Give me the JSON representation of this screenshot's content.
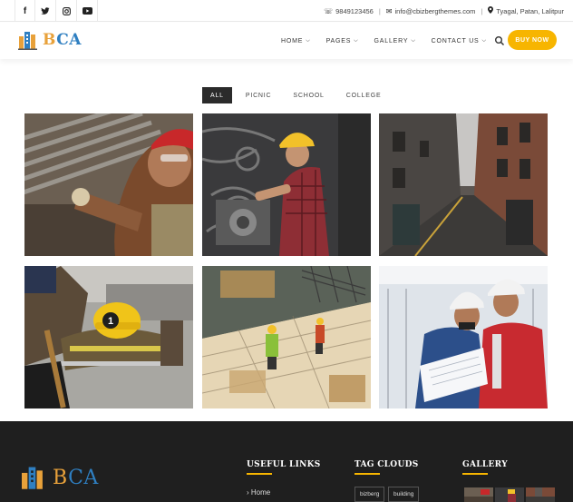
{
  "topbar": {
    "social": [
      {
        "icon": "facebook-icon",
        "glyph": "f"
      },
      {
        "icon": "twitter-icon",
        "glyph": "t"
      },
      {
        "icon": "instagram-icon",
        "glyph": "◎"
      },
      {
        "icon": "youtube-icon",
        "glyph": "▶"
      }
    ],
    "phone": "9849123456",
    "email": "info@cbizbergthemes.com",
    "address": "Tyagal, Patan, Lalitpur"
  },
  "header": {
    "logo_b": "B",
    "logo_ca": "CA",
    "nav": [
      {
        "label": "HOME"
      },
      {
        "label": "PAGES"
      },
      {
        "label": "GALLERY"
      },
      {
        "label": "CONTACT US"
      }
    ],
    "buy_label": "BUY NOW"
  },
  "filters": [
    "ALL",
    "PICNIC",
    "SCHOOL",
    "COLLEGE"
  ],
  "gallery": [
    {
      "subject": "worker-red-helmet"
    },
    {
      "subject": "worker-yellow-helmet-machinery"
    },
    {
      "subject": "narrow-alley"
    },
    {
      "subject": "firefighter-gear"
    },
    {
      "subject": "construction-site-aerial"
    },
    {
      "subject": "engineers-reviewing-plans"
    }
  ],
  "footer": {
    "logo_b": "B",
    "logo_ca": "CA",
    "useful_links_title": "USEFUL LINKS",
    "useful_links": [
      "Home"
    ],
    "tag_clouds_title": "TAG CLOUDS",
    "tags": [
      "bizberg",
      "building"
    ],
    "gallery_title": "GALLERY"
  },
  "colors": {
    "accent": "#f7b500",
    "footer_bg": "#1f1f1f",
    "logo_orange": "#e8a13a",
    "logo_blue": "#2f7fc1"
  }
}
